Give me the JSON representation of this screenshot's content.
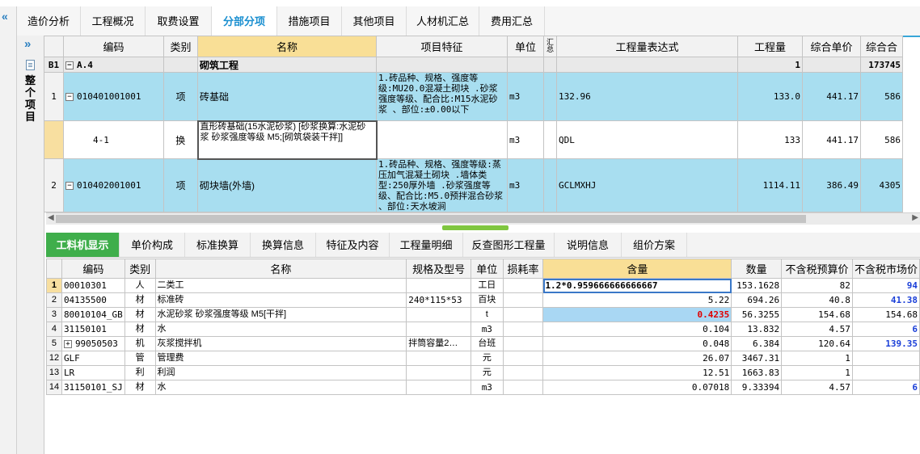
{
  "collapse_glyph": "«",
  "tabs": [
    "造价分析",
    "工程概况",
    "取费设置",
    "分部分项",
    "措施项目",
    "其他项目",
    "人材机汇总",
    "费用汇总"
  ],
  "active_tab": "分部分项",
  "nav": {
    "chevron": "»",
    "tree_label": "整个项目"
  },
  "top_grid": {
    "headers": [
      "编码",
      "类别",
      "名称",
      "项目特征",
      "单位",
      "汇总",
      "工程量表达式",
      "工程量",
      "综合单价",
      "综合合"
    ],
    "group": {
      "rownum": "B1",
      "code": "A.4",
      "name": "砌筑工程",
      "qty": "1",
      "total": "173745"
    },
    "rows": [
      {
        "rownum": "1",
        "code": "010401001001",
        "type": "项",
        "name": "砖基础",
        "features": "1.砖品种、规格、强度等级:MU20.0混凝土砌块 .砂浆强度等级、配合比:M15水泥砂浆 、部位:±0.00以下",
        "unit": "m3",
        "expr": "132.96",
        "qty": "133.0",
        "price": "441.17",
        "total": "586"
      },
      {
        "rownum": "",
        "code": "4-1",
        "type": "换",
        "name": "直形砖基础(15水泥砂浆) [砂浆换算:水泥砂浆 砂浆强度等级 M5;[砌筑袋装干拌]]",
        "features": "",
        "unit": "m3",
        "expr": "QDL",
        "qty": "133",
        "price": "441.17",
        "total": "586"
      },
      {
        "rownum": "2",
        "code": "010402001001",
        "type": "项",
        "name": "砌块墙(外墙)",
        "features": "1.砖品种、规格、强度等级:蒸压加气混凝土砌块 .墙体类型:250厚外墙 .砂浆强度等级、配合比:M5.0预拌混合砂浆 、部位:天水坡涧",
        "unit": "m3",
        "expr": "GCLMXHJ",
        "qty": "1114.11",
        "price": "386.49",
        "total": "4305"
      }
    ]
  },
  "bottom_tabs": [
    "工料机显示",
    "单价构成",
    "标准换算",
    "换算信息",
    "特征及内容",
    "工程量明细",
    "反查图形工程量",
    "说明信息",
    "组价方案"
  ],
  "bottom_grid": {
    "headers": [
      "编码",
      "类别",
      "名称",
      "规格及型号",
      "单位",
      "损耗率",
      "含量",
      "数量",
      "不含税预算价",
      "不含税市场价"
    ],
    "rows": [
      {
        "n": "1",
        "code": "00010301",
        "type": "人",
        "name": "二类工",
        "spec": "",
        "unit": "工日",
        "loss": "",
        "content": "1.2*0.959666666666667",
        "qty": "153.1628",
        "budget": "82",
        "market": "94"
      },
      {
        "n": "2",
        "code": "04135500",
        "type": "材",
        "name": "标准砖",
        "spec": "240*115*53",
        "unit": "百块",
        "loss": "",
        "content": "5.22",
        "qty": "694.26",
        "budget": "40.8",
        "market": "41.38"
      },
      {
        "n": "3",
        "code": "80010104_GB",
        "type": "材",
        "name": "水泥砂浆 砂浆强度等级 M5[干拌]",
        "spec": "",
        "unit": "t",
        "loss": "",
        "content": "0.4235",
        "qty": "56.3255",
        "budget": "154.68",
        "market": "154.68"
      },
      {
        "n": "4",
        "code": "31150101",
        "type": "材",
        "name": "水",
        "spec": "",
        "unit": "m3",
        "loss": "",
        "content": "0.104",
        "qty": "13.832",
        "budget": "4.57",
        "market": "6"
      },
      {
        "n": "5",
        "code": "99050503",
        "type": "机",
        "name": "灰浆搅拌机",
        "spec": "拌筒容量2…",
        "unit": "台班",
        "loss": "",
        "content": "0.048",
        "qty": "6.384",
        "budget": "120.64",
        "market": "139.35"
      },
      {
        "n": "12",
        "code": "GLF",
        "type": "管",
        "name": "管理费",
        "spec": "",
        "unit": "元",
        "loss": "",
        "content": "26.07",
        "qty": "3467.31",
        "budget": "1",
        "market": ""
      },
      {
        "n": "13",
        "code": "LR",
        "type": "利",
        "name": "利润",
        "spec": "",
        "unit": "元",
        "loss": "",
        "content": "12.51",
        "qty": "1663.83",
        "budget": "1",
        "market": ""
      },
      {
        "n": "14",
        "code": "31150101_SJ",
        "type": "材",
        "name": "水",
        "spec": "",
        "unit": "m3",
        "loss": "",
        "content": "0.07018",
        "qty": "9.33394",
        "budget": "4.57",
        "market": "6"
      }
    ]
  },
  "colors": {
    "accent": "#1a8fd0",
    "blue_row": "#a8def0",
    "green_tab": "#3fae4b",
    "highlight_header": "#f9df96"
  }
}
